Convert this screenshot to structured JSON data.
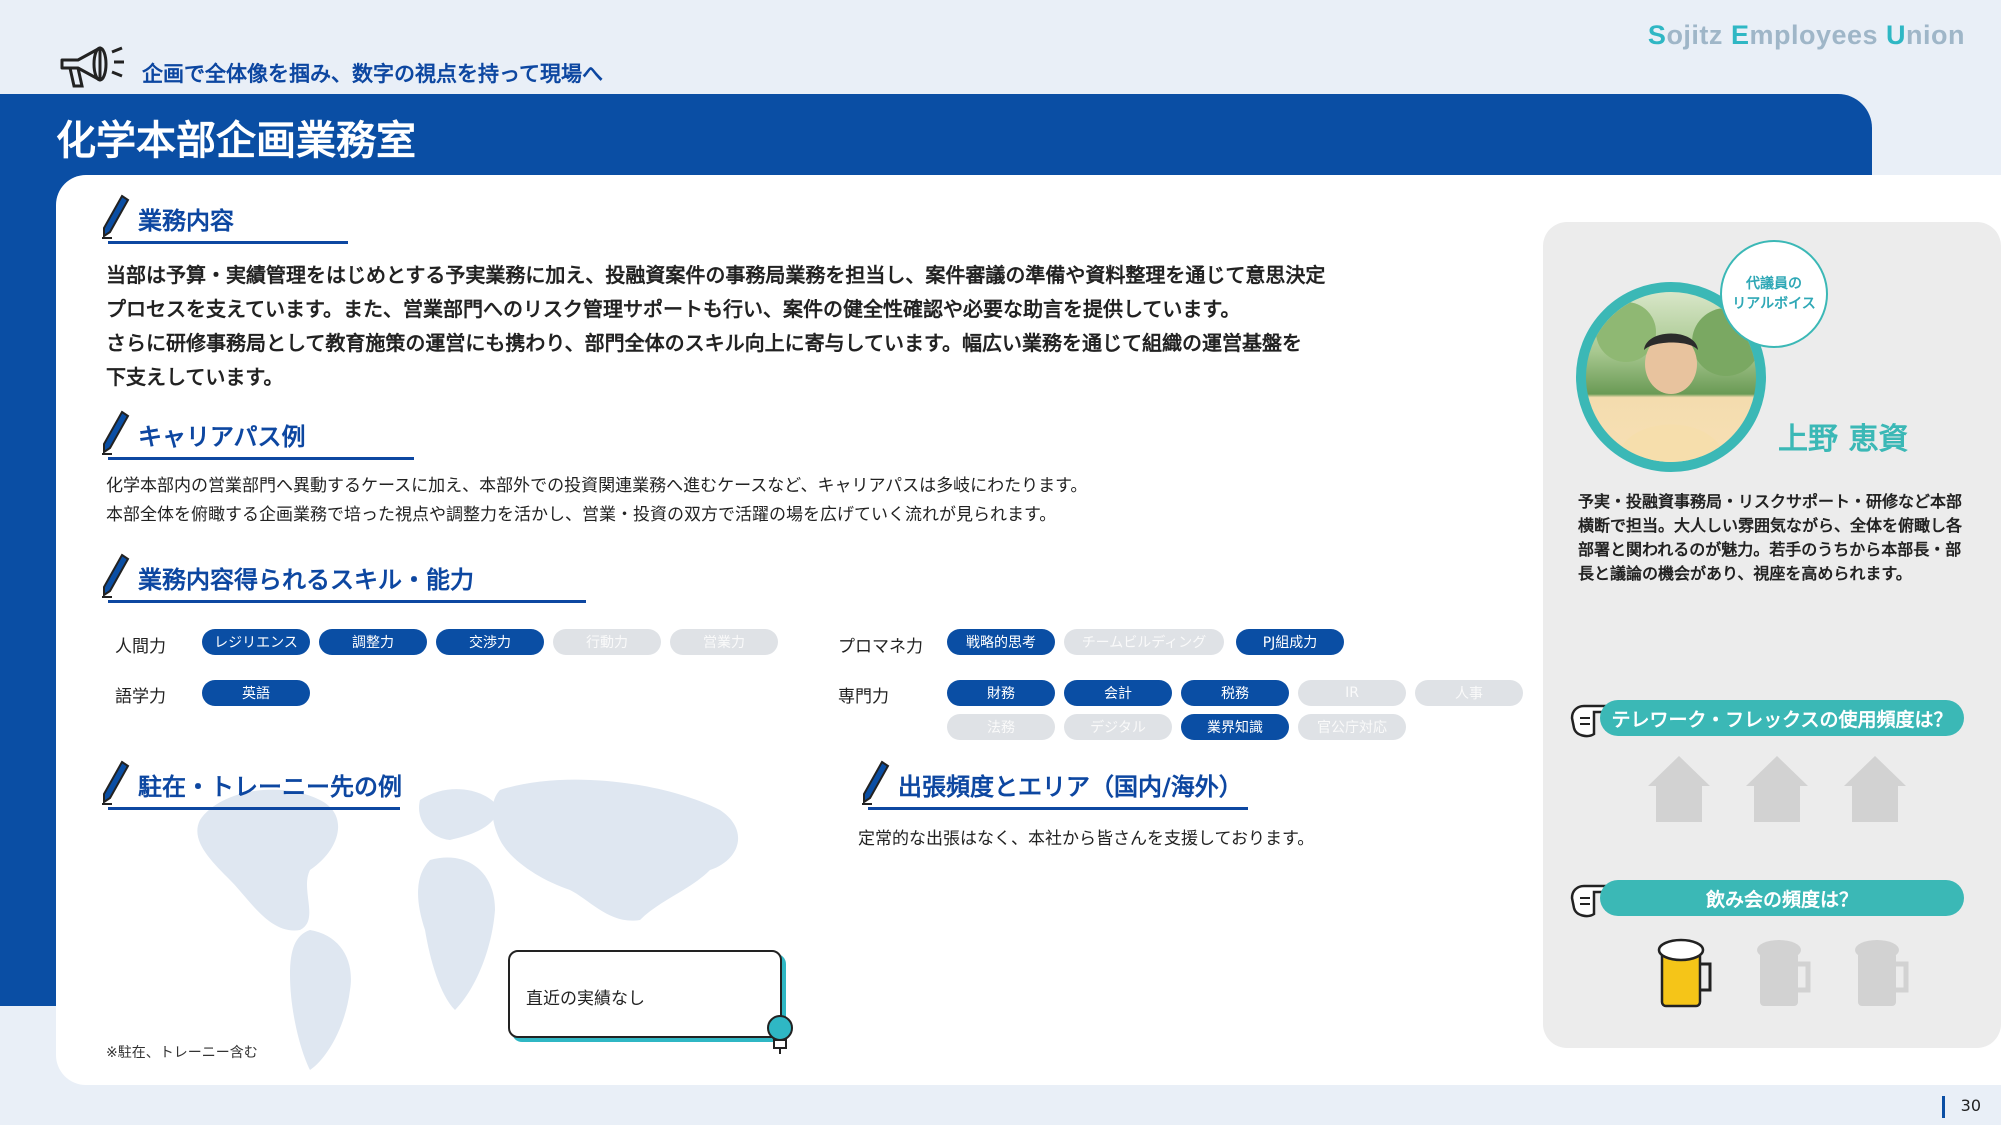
{
  "brand": {
    "letter_s": "S",
    "rest_1": "ojitz ",
    "letter_e": "E",
    "rest_2": "mployees ",
    "letter_u": "U",
    "rest_3": "nion"
  },
  "tagline": "企画で全体像を掴み、数字の視点を持って現場へ",
  "dept_title": "化学本部企画業務室",
  "sections": {
    "duties": {
      "heading": "業務内容",
      "lines": [
        "当部は予算・実績管理をはじめとする予実業務に加え、投融資案件の事務局業務を担当し、案件審議の準備や資料整理を通じて意思決定",
        "プロセスを支えています。また、営業部門へのリスク管理サポートも行い、案件の健全性確認や必要な助言を提供しています。",
        "さらに研修事務局として教育施策の運営にも携わり、部門全体のスキル向上に寄与しています。幅広い業務を通じて組織の運営基盤を",
        "下支えしています。"
      ]
    },
    "career": {
      "heading": "キャリアパス例",
      "lines": [
        "化学本部内の営業部門へ異動するケースに加え、本部外での投資関連業務へ進むケースなど、キャリアパスは多岐にわたります。",
        "本部全体を俯瞰する企画業務で培った視点や調整力を活かし、営業・投資の双方で活躍の場を広げていく流れが見られます。"
      ]
    },
    "skills": {
      "heading": "業務内容得られるスキル・能力",
      "groups": {
        "human": {
          "label": "人間力",
          "pills": [
            {
              "text": "レジリエンス",
              "on": true
            },
            {
              "text": "調整力",
              "on": true
            },
            {
              "text": "交渉力",
              "on": true
            },
            {
              "text": "行動力",
              "on": false
            },
            {
              "text": "営業力",
              "on": false
            }
          ]
        },
        "language": {
          "label": "語学力",
          "pills": [
            {
              "text": "英語",
              "on": true
            }
          ]
        },
        "proman": {
          "label": "プロマネ力",
          "pills": [
            {
              "text": "戦略的思考",
              "on": true
            },
            {
              "text": "チームビルディング",
              "on": false
            },
            {
              "text": "PJ組成力",
              "on": true
            }
          ]
        },
        "expert": {
          "label": "専門力",
          "pills": [
            {
              "text": "財務",
              "on": true
            },
            {
              "text": "会計",
              "on": true
            },
            {
              "text": "税務",
              "on": true
            },
            {
              "text": "IR",
              "on": false
            },
            {
              "text": "人事",
              "on": false
            },
            {
              "text": "法務",
              "on": false
            },
            {
              "text": "デジタル",
              "on": false
            },
            {
              "text": "業界知識",
              "on": true
            },
            {
              "text": "官公庁対応",
              "on": false
            }
          ]
        }
      }
    },
    "posting": {
      "heading": "駐在・トレーニー先の例",
      "callout": "直近の実績なし",
      "note": "※駐在、トレーニー含む"
    },
    "travel": {
      "heading": "出張頻度とエリア（国内/海外）",
      "text": "定常的な出張はなく、本社から皆さんを支援しております。"
    }
  },
  "voice": {
    "bubble_line1": "代議員の",
    "bubble_line2": "リアルボイス",
    "name": "上野 恵資",
    "description": "予実・投融資事務局・リスクサポート・研修など本部横断で担当。大人しい雰囲気ながら、全体を俯瞰し各部署と関われるのが魅力。若手のうちから本部長・部長と議論の機会があり、視座を高められます。",
    "telework_question": "テレワーク・フレックスの使用頻度は？",
    "telework_level": 0,
    "telework_max": 3,
    "drinking_question": "飲み会の頻度は？",
    "drinking_level": 1,
    "drinking_max": 3
  },
  "colors": {
    "navy": "#0a4ea4",
    "teal": "#3bb8b6",
    "pill_off": "#dfe2e6"
  },
  "page_number": "30"
}
